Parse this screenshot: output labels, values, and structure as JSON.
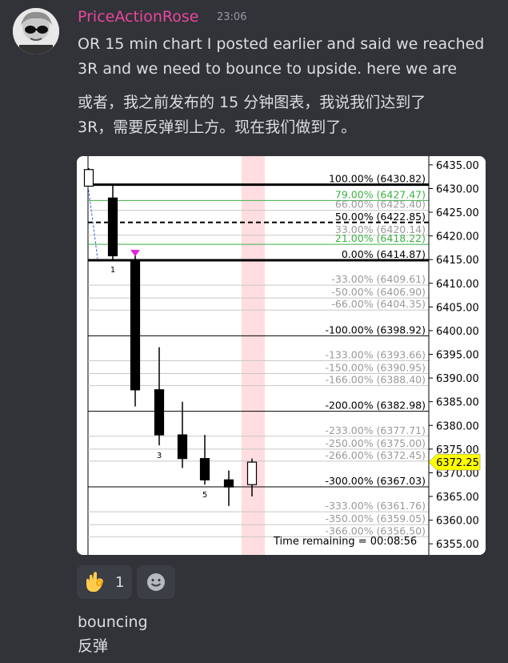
{
  "message": {
    "username": "PriceActionRose",
    "timestamp": "23:06",
    "line1": "OR 15 min chart I posted earlier and said we reached",
    "line2": "3R and we need to bounce to upside. here we are",
    "line3": "或者，我之前发布的 15 分钟图表，我说我们达到了",
    "line4": "3R，需要反弹到上方。现在我们做到了。",
    "followup1": "bouncing",
    "followup2": "反弹"
  },
  "reactions": [
    {
      "emoji": "ok-hand",
      "count": "1"
    }
  ],
  "colors": {
    "background": "#313338",
    "username": "#eb459f",
    "fib_green": "#3cb043",
    "fib_gray": "#9a9a9a",
    "price_tag": "#ffff00",
    "current_bar_highlight": "#ffdde0"
  },
  "chart_data": {
    "type": "candlestick",
    "y_axis_ticks": [
      "6435.00",
      "6430.00",
      "6425.00",
      "6420.00",
      "6415.00",
      "6410.00",
      "6405.00",
      "6400.00",
      "6395.00",
      "6390.00",
      "6385.00",
      "6380.00",
      "6375.00",
      "6370.00",
      "6365.00",
      "6360.00",
      "6355.00"
    ],
    "ylim": [
      6353,
      6436.5
    ],
    "current_price": "6372.25",
    "time_remaining": "Time remaining = 00:08:56",
    "fib_levels": [
      {
        "label": "100.00% (6430.82)",
        "price": 6430.82,
        "style": "solid-heavy"
      },
      {
        "label": "79.00% (6427.47)",
        "price": 6427.47,
        "style": "green"
      },
      {
        "label": "66.00% (6425.40)",
        "price": 6425.4,
        "style": "gray"
      },
      {
        "label": "50.00% (6422.85)",
        "price": 6422.85,
        "style": "dashed"
      },
      {
        "label": "33.00% (6420.14)",
        "price": 6420.14,
        "style": "gray"
      },
      {
        "label": "21.00% (6418.22)",
        "price": 6418.22,
        "style": "green"
      },
      {
        "label": "0.00% (6414.87)",
        "price": 6414.87,
        "style": "solid-heavy"
      },
      {
        "label": "-33.00% (6409.61)",
        "price": 6409.61,
        "style": "gray"
      },
      {
        "label": "-50.00% (6406.90)",
        "price": 6406.9,
        "style": "gray"
      },
      {
        "label": "-66.00% (6404.35)",
        "price": 6404.35,
        "style": "gray"
      },
      {
        "label": "-100.00% (6398.92)",
        "price": 6398.92,
        "style": "solid"
      },
      {
        "label": "-133.00% (6393.66)",
        "price": 6393.66,
        "style": "gray"
      },
      {
        "label": "-150.00% (6390.95)",
        "price": 6390.95,
        "style": "gray"
      },
      {
        "label": "-166.00% (6388.40)",
        "price": 6388.4,
        "style": "gray"
      },
      {
        "label": "-200.00% (6382.98)",
        "price": 6382.98,
        "style": "solid"
      },
      {
        "label": "-233.00% (6377.71)",
        "price": 6377.71,
        "style": "gray"
      },
      {
        "label": "-250.00% (6375.00)",
        "price": 6375.0,
        "style": "gray"
      },
      {
        "label": "-266.00% (6372.45)",
        "price": 6372.45,
        "style": "gray"
      },
      {
        "label": "-300.00% (6367.03)",
        "price": 6367.03,
        "style": "solid"
      },
      {
        "label": "-333.00% (6361.76)",
        "price": 6361.76,
        "style": "gray"
      },
      {
        "label": "-350.00% (6359.05)",
        "price": 6359.05,
        "style": "gray"
      },
      {
        "label": "-366.00% (6356.50)",
        "price": 6356.5,
        "style": "gray"
      }
    ],
    "candles": [
      {
        "open": 6430.5,
        "high": 6434.3,
        "low": 6433.0,
        "close": 6434.0,
        "label": ""
      },
      {
        "open": 6428.0,
        "high": 6431.0,
        "low": 6415.0,
        "close": 6415.8,
        "label": "1"
      },
      {
        "open": 6415.0,
        "high": 6416.0,
        "low": 6384.0,
        "close": 6387.5,
        "label": ""
      },
      {
        "open": 6387.5,
        "high": 6396.5,
        "low": 6383.5,
        "close": 6387.5,
        "label": ""
      },
      {
        "open": 6387.5,
        "high": 6387.7,
        "low": 6375.8,
        "close": 6378.0,
        "label": "3"
      },
      {
        "open": 6378.0,
        "high": 6385.0,
        "low": 6371.0,
        "close": 6373.0,
        "label": ""
      },
      {
        "open": 6373.0,
        "high": 6378.0,
        "low": 6367.5,
        "close": 6368.5,
        "label": "5"
      },
      {
        "open": 6368.5,
        "high": 6370.5,
        "low": 6363.0,
        "close": 6367.0,
        "label": ""
      },
      {
        "open": 6367.5,
        "high": 6373.0,
        "low": 6365.0,
        "close": 6372.25,
        "label": ""
      }
    ]
  }
}
